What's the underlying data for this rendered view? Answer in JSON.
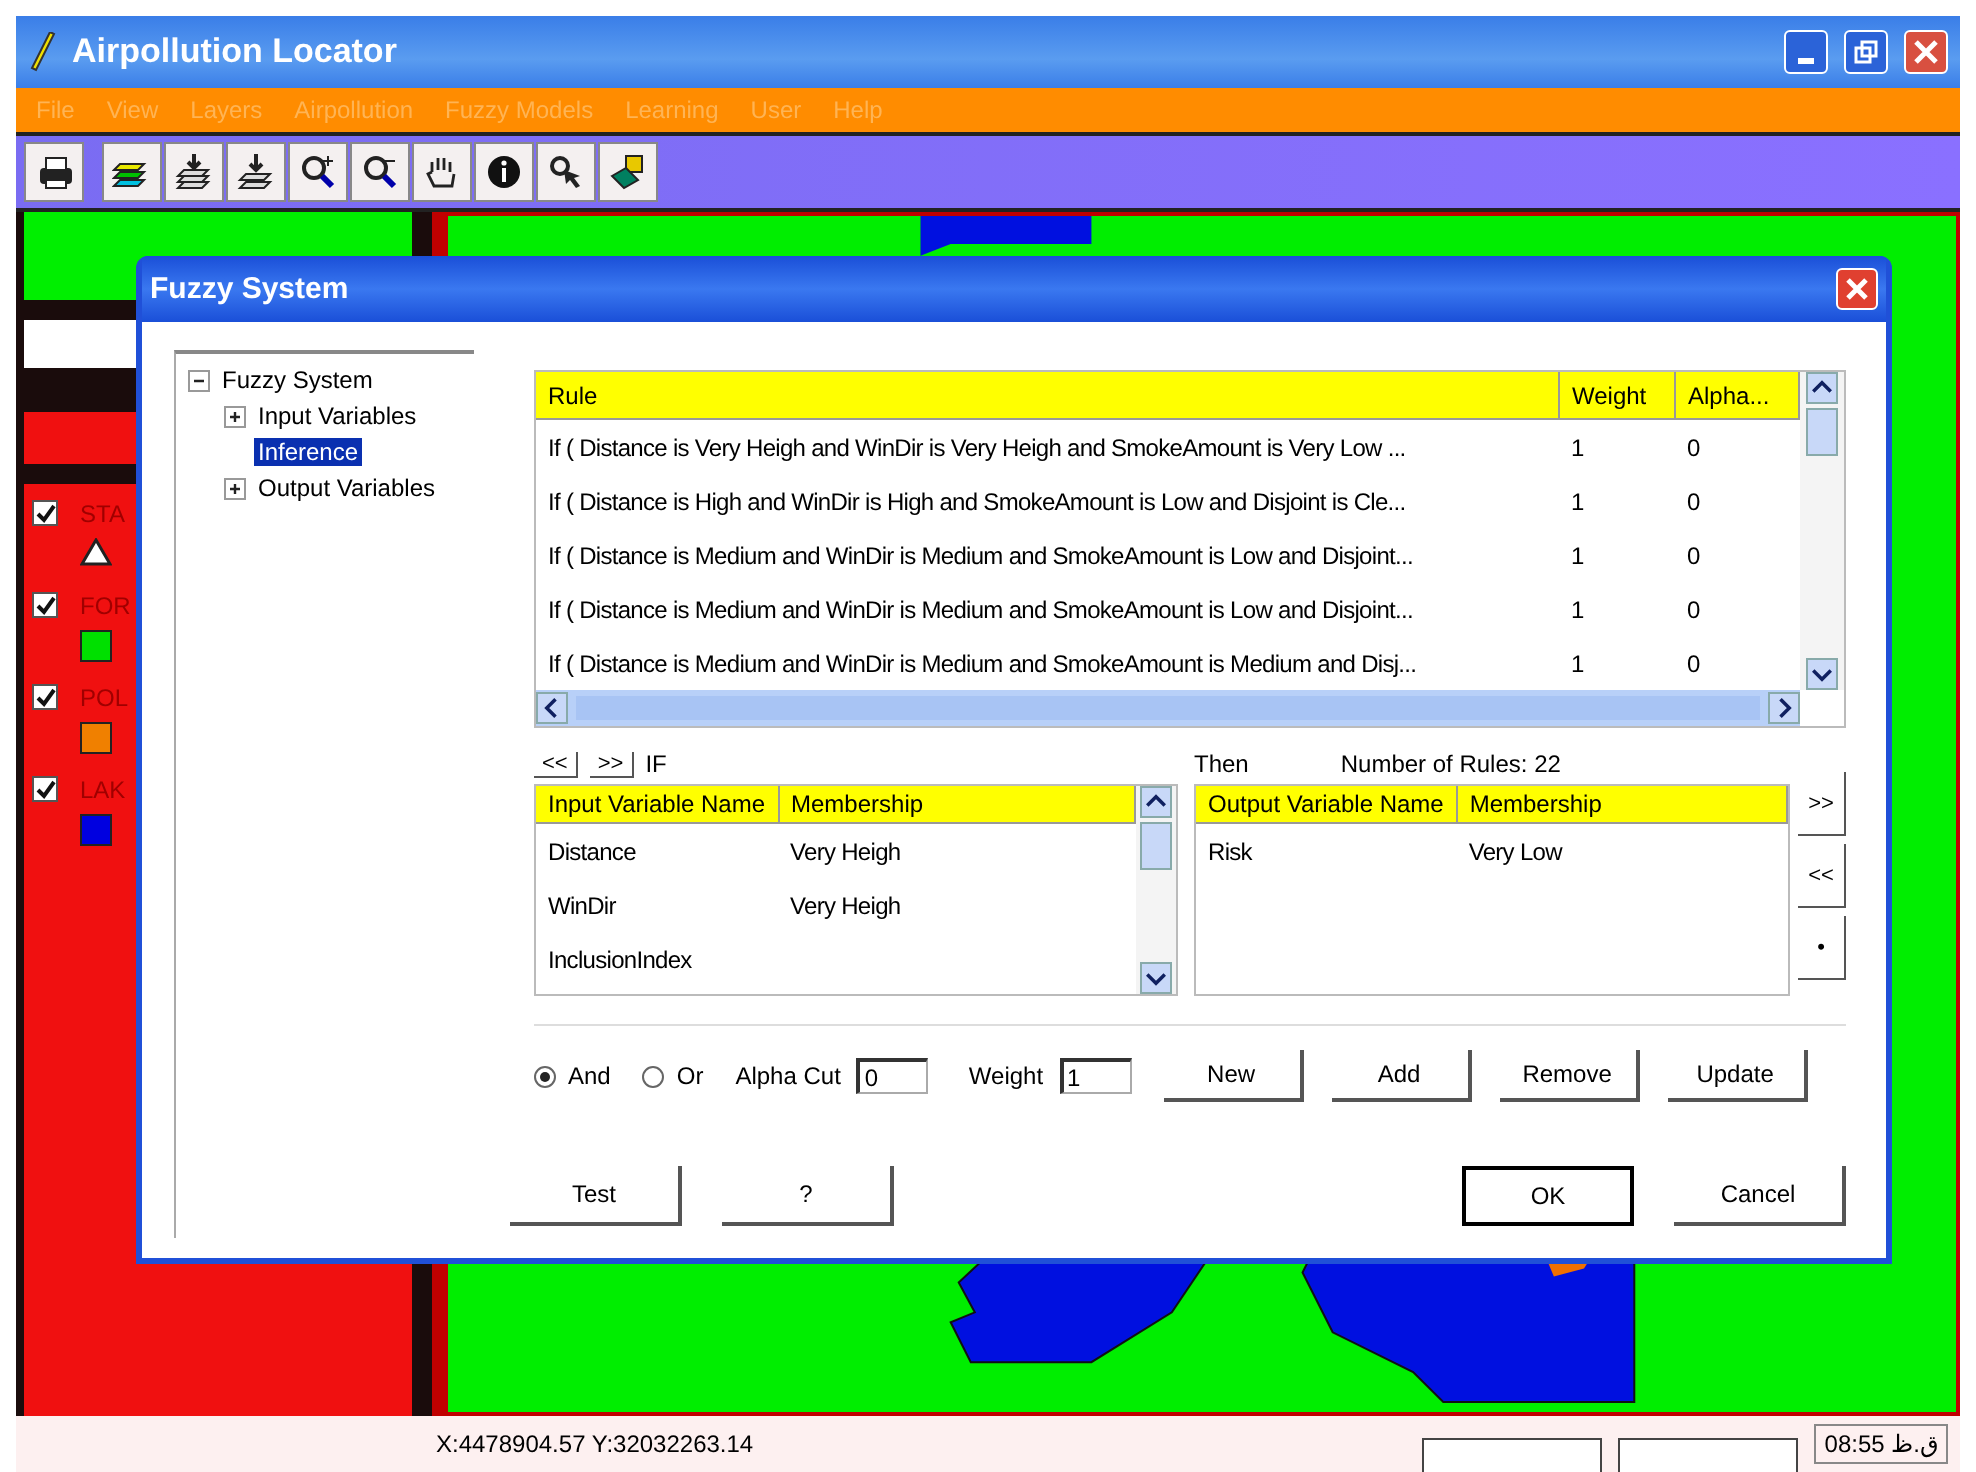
{
  "window": {
    "title": "Airpollution Locator"
  },
  "menu": [
    "File",
    "View",
    "Layers",
    "Airpollution",
    "Fuzzy Models",
    "Learning",
    "User",
    "Help"
  ],
  "layers": [
    {
      "label": "STA",
      "checked": true,
      "kind": "triangle",
      "color": "#ffffff"
    },
    {
      "label": "FOR",
      "checked": true,
      "kind": "square",
      "color": "#00e000"
    },
    {
      "label": "POL",
      "checked": true,
      "kind": "square",
      "color": "#f08000"
    },
    {
      "label": "LAK",
      "checked": true,
      "kind": "square",
      "color": "#0000e0"
    }
  ],
  "dialog": {
    "title": "Fuzzy System",
    "tree": {
      "label": "Fuzzy System",
      "expanded": true,
      "selected": false,
      "children": [
        {
          "label": "Input Variables",
          "expanded": false,
          "selected": false
        },
        {
          "label": "Inference",
          "selected": true
        },
        {
          "label": "Output Variables",
          "expanded": false,
          "selected": false
        }
      ]
    },
    "rules": {
      "columns": [
        "Rule",
        "Weight",
        "Alpha..."
      ],
      "rows": [
        [
          "If ( Distance is Very Heigh and WinDir is Very Heigh and SmokeAmount is Very Low ...",
          "1",
          "0"
        ],
        [
          "If ( Distance is High and WinDir is High and SmokeAmount is Low and Disjoint is Cle...",
          "1",
          "0"
        ],
        [
          "If ( Distance is Medium and WinDir is Medium and SmokeAmount is Low and Disjoint...",
          "1",
          "0"
        ],
        [
          "If ( Distance is Medium and WinDir is Medium and SmokeAmount is Low and Disjoint...",
          "1",
          "0"
        ],
        [
          "If ( Distance is Medium and WinDir is Medium and SmokeAmount is Medium and Disj...",
          "1",
          "0"
        ]
      ]
    },
    "nav_buttons": [
      "<<",
      ">>"
    ],
    "if_label": "IF",
    "then_label": "Then",
    "rule_count": "Number of Rules: 22",
    "inputs": {
      "columns": [
        "Input Variable Name",
        "Membership"
      ],
      "rows": [
        {
          "name": "Distance",
          "membership": "Very Heigh"
        },
        {
          "name": "WinDir",
          "membership": "Very Heigh"
        },
        {
          "name": "InclusionIndex"
        }
      ]
    },
    "outputs": {
      "columns": [
        "Output Variable Name",
        "Membership"
      ],
      "rows": [
        {
          "name": "Risk",
          "membership": "Very Low"
        }
      ]
    },
    "side_buttons": [
      ">>",
      "<<",
      "•"
    ],
    "operators": [
      {
        "label": "And",
        "selected": true
      },
      {
        "label": "Or",
        "selected": false
      }
    ],
    "alpha_cut": {
      "label": "Alpha Cut",
      "value": "0"
    },
    "weight": {
      "label": "Weight",
      "value": "1"
    },
    "action_buttons": [
      "New",
      "Add",
      "Remove",
      "Update"
    ],
    "footer_buttons": [
      {
        "label": "Test",
        "default": false
      },
      {
        "label": "?",
        "default": false
      },
      {
        "label": "OK",
        "default": true
      },
      {
        "label": "Cancel",
        "default": false
      }
    ]
  },
  "status_bar": {
    "coordinates": "X:4478904.57 Y:32032263.14",
    "time": "08:55 ق.ظ"
  }
}
